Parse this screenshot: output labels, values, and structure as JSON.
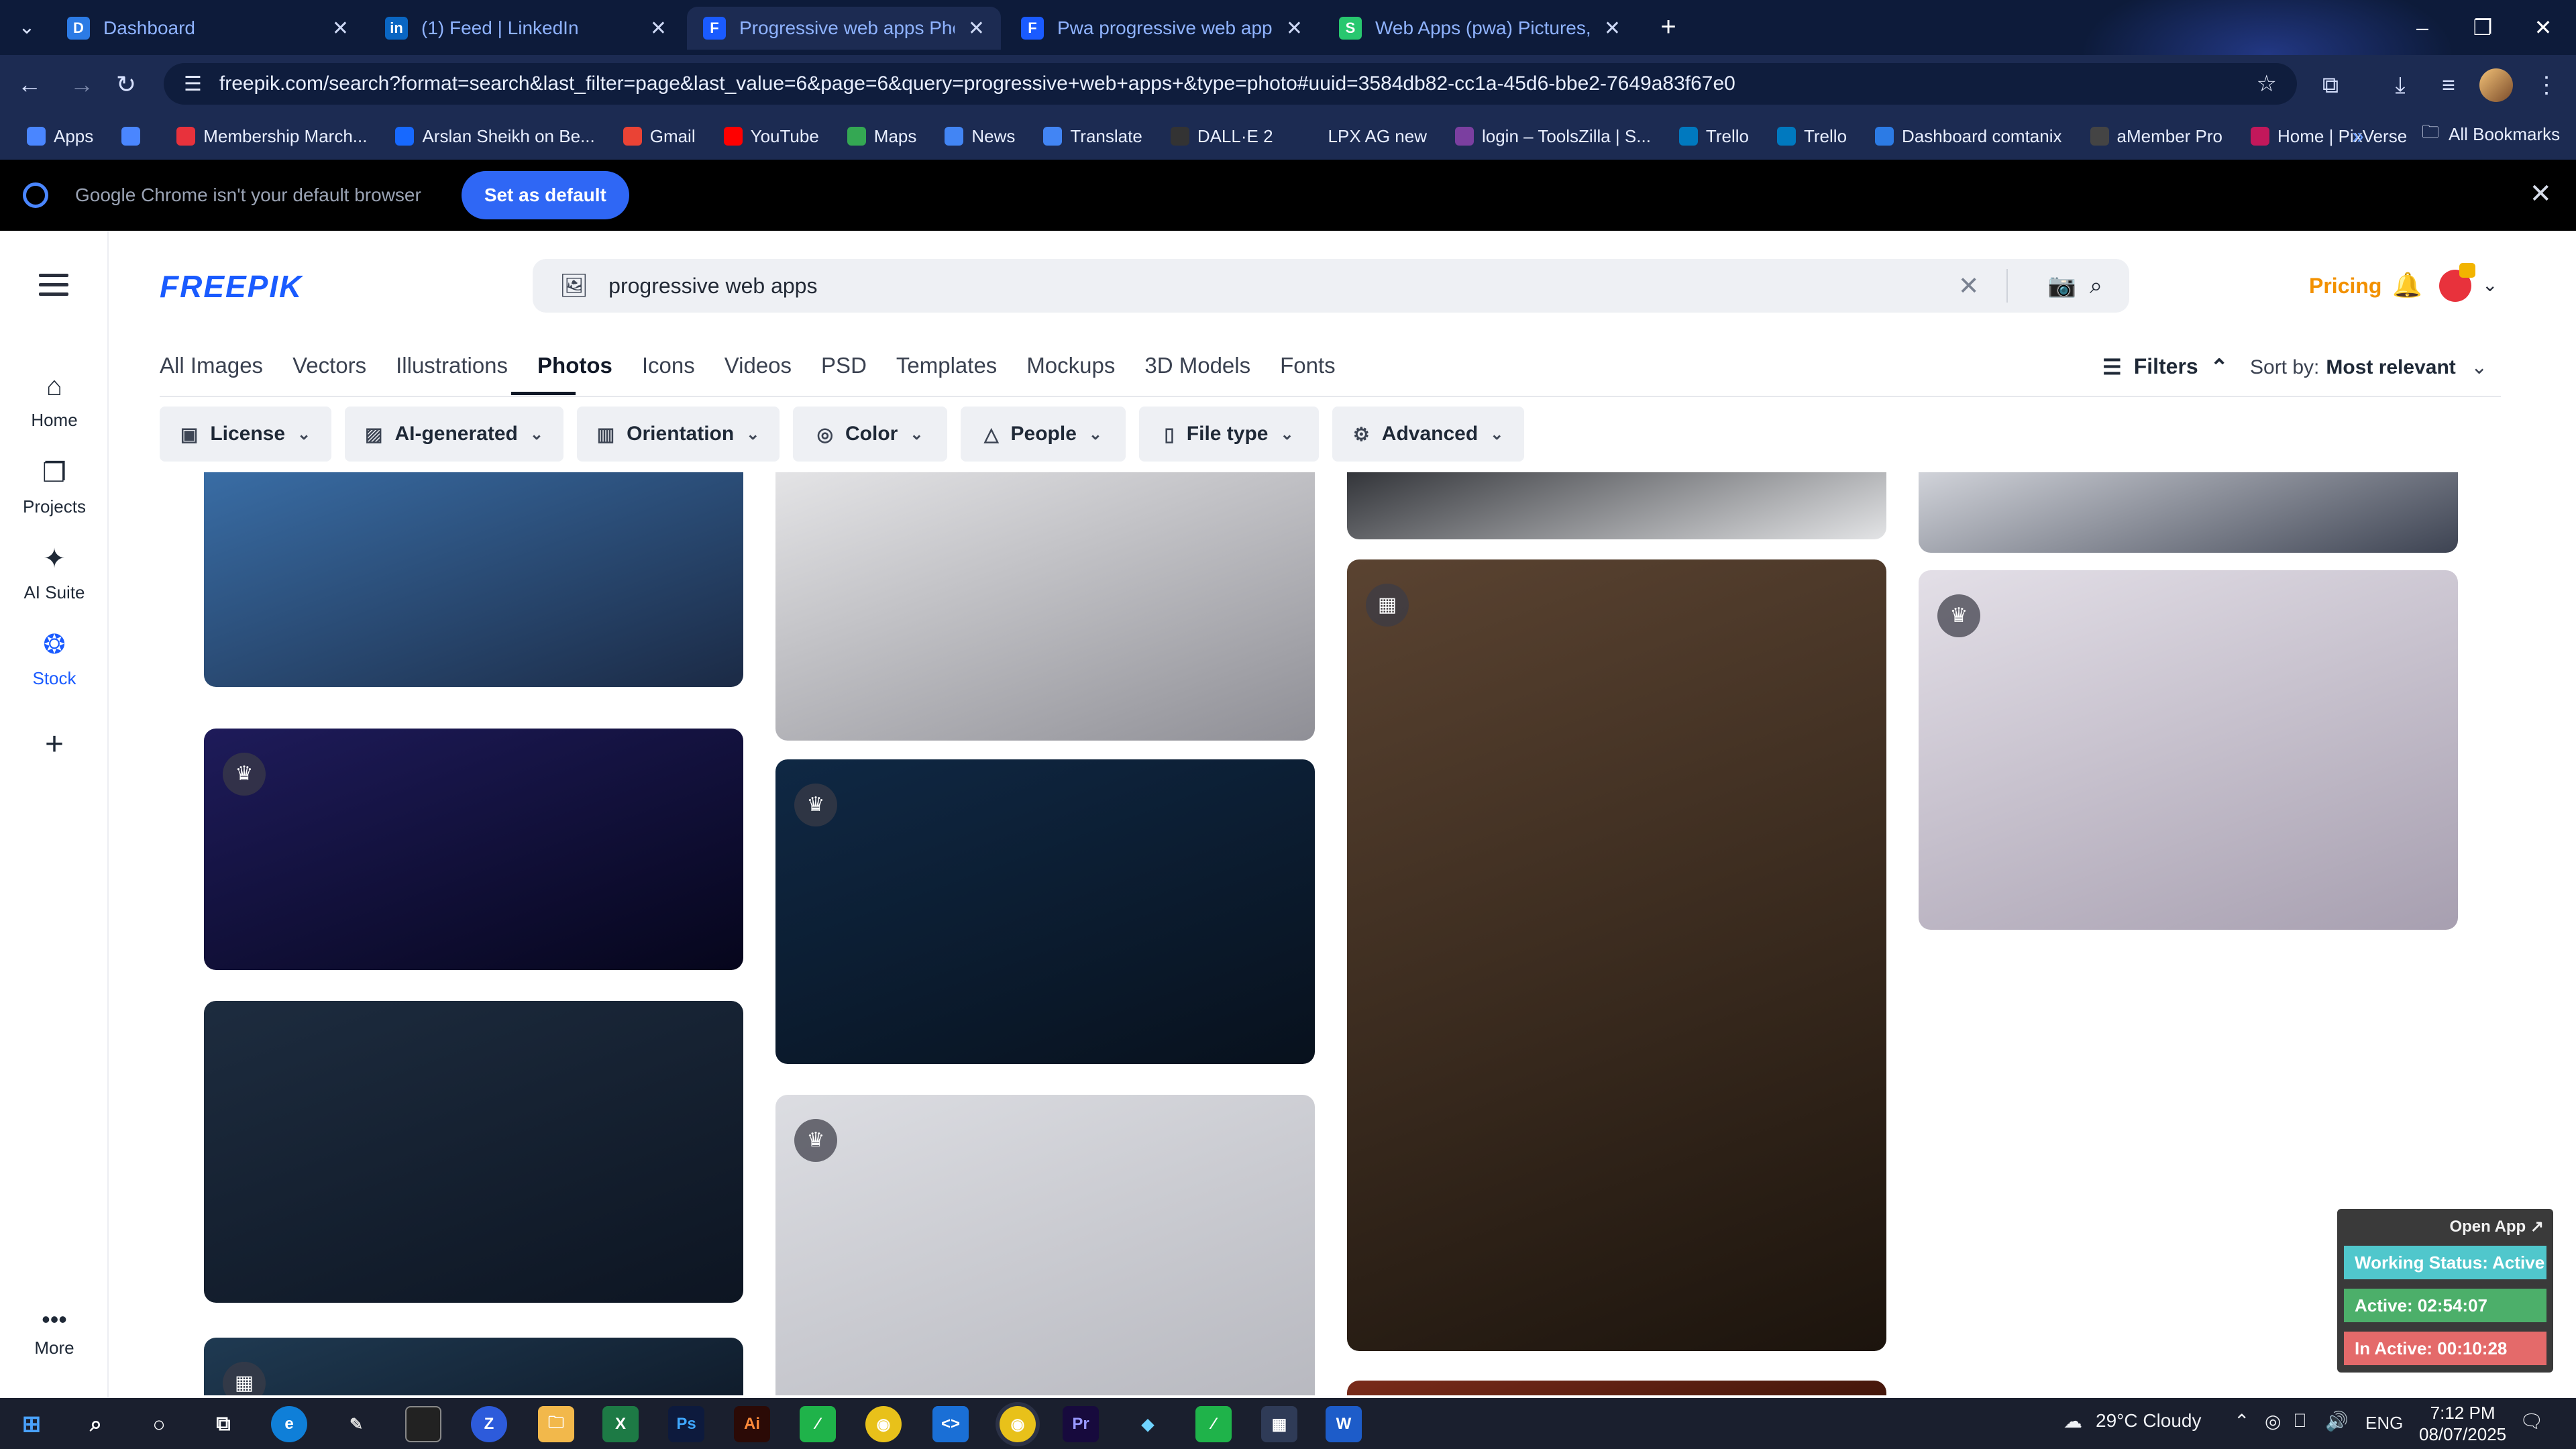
{
  "browser": {
    "tabs": [
      {
        "title": "Dashboard",
        "favicon": "D",
        "color": "#2c7be5",
        "active": false
      },
      {
        "title": "(1) Feed | LinkedIn",
        "favicon": "in",
        "color": "#0a66c2",
        "active": false
      },
      {
        "title": "Progressive web apps Photos | ·",
        "favicon": "F",
        "color": "#1a5bff",
        "active": true
      },
      {
        "title": "Pwa progressive web apps sma",
        "favicon": "F",
        "color": "#1a5bff",
        "active": false
      },
      {
        "title": "Web Apps (pwa) Pictures, Imag",
        "favicon": "S",
        "color": "#28c76f",
        "active": false
      }
    ],
    "url": "freepik.com/search?format=search&last_filter=page&last_value=6&page=6&query=progressive+web+apps+&type=photo#uuid=3584db82-cc1a-45d6-bbe2-7649a83f67e0",
    "bookmarks": [
      {
        "label": "Apps",
        "color": "#4a86ff"
      },
      {
        "label": "",
        "color": "#4a86ff"
      },
      {
        "label": "Membership March...",
        "color": "#e8323c"
      },
      {
        "label": "Arslan Sheikh on Be...",
        "color": "#1769ff"
      },
      {
        "label": "Gmail",
        "color": "#ea4335"
      },
      {
        "label": "YouTube",
        "color": "#ff0000"
      },
      {
        "label": "Maps",
        "color": "#34a853"
      },
      {
        "label": "News",
        "color": "#4285f4"
      },
      {
        "label": "Translate",
        "color": "#4285f4"
      },
      {
        "label": "DALL·E 2",
        "color": "#333333"
      },
      {
        "label": "LPX AG new",
        "color": "#1c2b52"
      },
      {
        "label": "login – ToolsZilla | S...",
        "color": "#7b3fa0"
      },
      {
        "label": "Trello",
        "color": "#0079bf"
      },
      {
        "label": "Trello",
        "color": "#0079bf"
      },
      {
        "label": "Dashboard comtanix",
        "color": "#2c7be5"
      },
      {
        "label": "aMember Pro",
        "color": "#444444"
      },
      {
        "label": "Home | PixVerse",
        "color": "#c2185b"
      }
    ],
    "all_bookmarks": "All Bookmarks",
    "banner_message": "Google Chrome isn't your default browser",
    "banner_button": "Set as default"
  },
  "rail": {
    "items": [
      {
        "label": "Home",
        "icon": "⌂"
      },
      {
        "label": "Projects",
        "icon": "❐"
      },
      {
        "label": "AI Suite",
        "icon": "✦"
      },
      {
        "label": "Stock",
        "icon": "❂"
      }
    ],
    "more": "More"
  },
  "header": {
    "logo": "FREEPIK",
    "search_query": "progressive web apps",
    "pricing": "Pricing"
  },
  "categories": [
    "All Images",
    "Vectors",
    "Illustrations",
    "Photos",
    "Icons",
    "Videos",
    "PSD",
    "Templates",
    "Mockups",
    "3D Models",
    "Fonts"
  ],
  "active_category": "Photos",
  "filters_label": "Filters",
  "sort": {
    "label": "Sort by:",
    "value": "Most relevant"
  },
  "filter_pills": [
    {
      "label": "License",
      "icon": "▣"
    },
    {
      "label": "AI-generated",
      "icon": "▨"
    },
    {
      "label": "Orientation",
      "icon": "▥"
    },
    {
      "label": "Color",
      "icon": "◎"
    },
    {
      "label": "People",
      "icon": "△"
    },
    {
      "label": "File type",
      "icon": "▯"
    },
    {
      "label": "Advanced",
      "icon": "⚙"
    }
  ],
  "gallery": [
    {
      "name": "photo-man-with-phone",
      "colors": [
        "#3a6fa8",
        "#1b2a45"
      ],
      "badge": "",
      "dark": true
    },
    {
      "name": "photo-phone-search-hand",
      "colors": [
        "#1e1b5a",
        "#06061c"
      ],
      "badge": "♛"
    },
    {
      "name": "photo-laptop-dashboard",
      "colors": [
        "#1d2c3f",
        "#0d1522"
      ],
      "badge": ""
    },
    {
      "name": "photo-bottom-col1",
      "colors": [
        "#1f3a52",
        "#0b1320"
      ],
      "badge": "▦"
    },
    {
      "name": "photo-keyboard-tablet",
      "colors": [
        "#e6e6e8",
        "#8f8f96"
      ],
      "badge": ""
    },
    {
      "name": "photo-laptop-green-phone",
      "colors": [
        "#0f2844",
        "#08111d"
      ],
      "badge": "♛"
    },
    {
      "name": "photo-cloud-phone-icons",
      "colors": [
        "#dcdde2",
        "#b7b8bf"
      ],
      "badge": "♛"
    },
    {
      "name": "photo-desk-top-col3",
      "colors": [
        "#2a2c31",
        "#e3e4e6"
      ],
      "badge": ""
    },
    {
      "name": "photo-meeting-screen",
      "colors": [
        "#5a4331",
        "#1c140d"
      ],
      "badge": "▦"
    },
    {
      "name": "photo-bottom-col3",
      "colors": [
        "#7a2b1a",
        "#3d1409"
      ],
      "badge": ""
    },
    {
      "name": "photo-desk-top-col4",
      "colors": [
        "#d8dae0",
        "#3d4352"
      ],
      "badge": ""
    },
    {
      "name": "photo-laptop-app-icons",
      "colors": [
        "#e3dfe7",
        "#a79fb0"
      ],
      "badge": "♛"
    }
  ],
  "widget": {
    "open_app": "Open App ↗",
    "status": "Working Status: Active",
    "active": "Active: 02:54:07",
    "inactive": "In Active: 00:10:28",
    "colors": {
      "status": "#50c7cc",
      "active": "#4caf6a",
      "inactive": "#e46a6a"
    }
  },
  "taskbar": {
    "weather": "29°C  Cloudy",
    "lang": "ENG",
    "time": "7:12 PM",
    "date": "08/07/2025"
  }
}
